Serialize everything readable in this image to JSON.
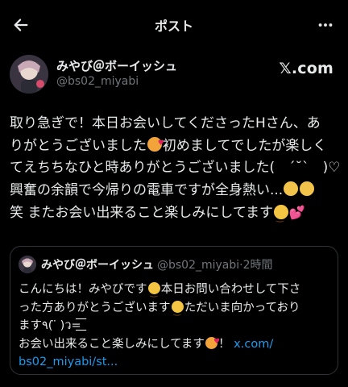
{
  "header": {
    "title": "ポスト"
  },
  "author": {
    "display_name": "みやび＠ボーイッシュ",
    "handle": "@bs02_miyabi",
    "brand": "𝕏.com"
  },
  "post": {
    "line1": "取り急ぎで！本日お会いしてくださったHさん、あ",
    "line2a": "りがとうございました",
    "line2b": "初めましてでしたが楽しく",
    "line3": "てえちちなひと時ありがとうございました(　´˘`　)♡",
    "line4": "興奮の余韻で今帰りの電車ですが全身熱い...",
    "line5": "笑 またお会い出来ること楽しみにしてます"
  },
  "quote": {
    "display_name": "みやび＠ボーイッシュ",
    "handle": "@bs02_miyabi",
    "dot": "·",
    "time": "2時間",
    "line1a": "こんにちは！みやびです",
    "line1b": "本日お問い合わせして下さ",
    "line2a": "った方ありがとうございます",
    "line2b": "ただいま向かっており",
    "line3": "ます٩( ̈ )ว=͟͟͞͞",
    "line4a": "お会い出来ること楽しみにしてます",
    "line4b": "！",
    "link1": "x.com/",
    "link2": "bs02_miyabi/st..."
  },
  "icons": {
    "back": "arrow-left-icon",
    "more": "more-horizontal-icon",
    "emoji_hearts": "smiling-face-with-hearts",
    "emoji_salute": "saluting-face",
    "emoji_relieved": "relieved-face",
    "emoji_two_hearts": "two-hearts"
  },
  "colors": {
    "background": "#000000",
    "text": "#e7e9ea",
    "secondary": "#71767b",
    "link": "#1d9bf0",
    "border": "#2f3336"
  }
}
